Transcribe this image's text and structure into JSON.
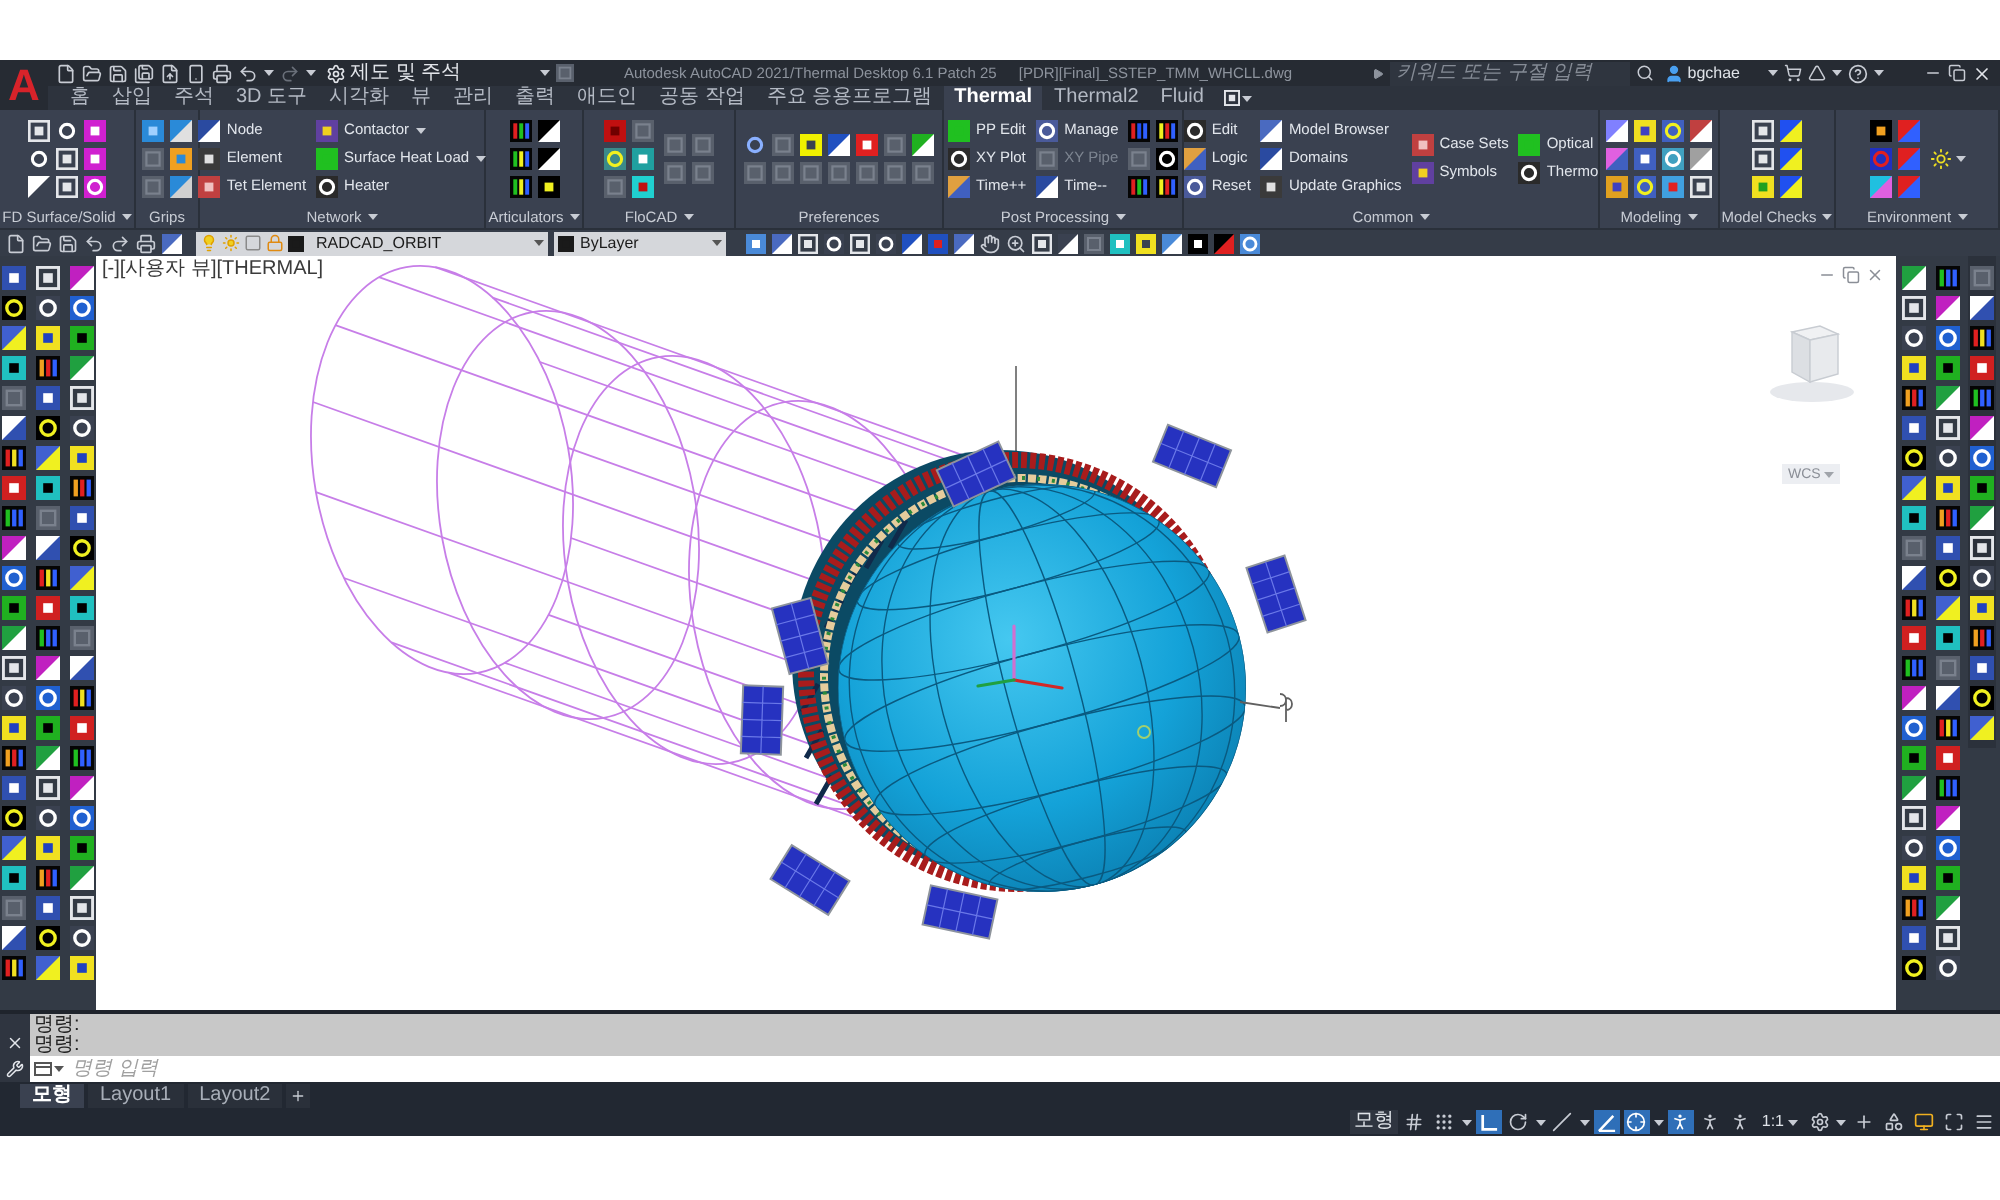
{
  "title_bar": {
    "logo": "A",
    "workspace": "제도 및 주석",
    "title": "Autodesk AutoCAD 2021/Thermal Desktop 6.1 Patch 25",
    "file": "[PDR][Final]_SSTEP_TMM_WHCLL.dwg",
    "search": {
      "placeholder": "키워드 또는 구절 입력"
    },
    "user": "bgchae"
  },
  "ribbon_tabs": [
    {
      "label": "홈",
      "selected": false
    },
    {
      "label": "삽입",
      "selected": false
    },
    {
      "label": "주석",
      "selected": false
    },
    {
      "label": "3D 도구",
      "selected": false
    },
    {
      "label": "시각화",
      "selected": false
    },
    {
      "label": "뷰",
      "selected": false
    },
    {
      "label": "관리",
      "selected": false
    },
    {
      "label": "출력",
      "selected": false
    },
    {
      "label": "애드인",
      "selected": false
    },
    {
      "label": "공동 작업",
      "selected": false
    },
    {
      "label": "주요 응용프로그램",
      "selected": false
    },
    {
      "label": "Thermal",
      "selected": true
    },
    {
      "label": "Thermal2",
      "selected": false
    },
    {
      "label": "Fluid",
      "selected": false
    }
  ],
  "ribbon_panels": [
    {
      "title": "FD Surface/Solid",
      "menu": true
    },
    {
      "title": "Grips",
      "menu": false
    },
    {
      "title": "Network",
      "menu": true,
      "columns": [
        [
          {
            "label": "Node",
            "dropdown": false,
            "disabled": false
          },
          {
            "label": "Element",
            "dropdown": false,
            "disabled": false
          },
          {
            "label": "Tet Element",
            "dropdown": false,
            "disabled": false
          }
        ],
        [
          {
            "label": "Contactor",
            "dropdown": true,
            "disabled": false
          },
          {
            "label": "Surface Heat Load",
            "dropdown": true,
            "disabled": false
          },
          {
            "label": "Heater",
            "dropdown": false,
            "disabled": false
          }
        ]
      ]
    },
    {
      "title": "Articulators",
      "menu": true
    },
    {
      "title": "FloCAD",
      "menu": true
    },
    {
      "title": "Preferences",
      "menu": false
    },
    {
      "title": "Post Processing",
      "menu": true,
      "columns": [
        [
          {
            "label": "PP Edit",
            "dropdown": false,
            "disabled": false
          },
          {
            "label": "XY Plot",
            "dropdown": false,
            "disabled": false
          },
          {
            "label": "Time++",
            "dropdown": false,
            "disabled": false
          }
        ],
        [
          {
            "label": "Manage",
            "dropdown": false,
            "disabled": false
          },
          {
            "label": "XY Pipe",
            "dropdown": false,
            "disabled": true
          },
          {
            "label": "Time--",
            "dropdown": false,
            "disabled": false
          }
        ]
      ]
    },
    {
      "title": "Common",
      "menu": true,
      "columns": [
        [
          {
            "label": "Edit",
            "dropdown": false,
            "disabled": false
          },
          {
            "label": "Logic",
            "dropdown": false,
            "disabled": false
          },
          {
            "label": "Reset",
            "dropdown": false,
            "disabled": false
          }
        ],
        [
          {
            "label": "Model Browser",
            "dropdown": false,
            "disabled": false
          },
          {
            "label": "Domains",
            "dropdown": false,
            "disabled": false
          },
          {
            "label": "Update Graphics",
            "dropdown": false,
            "disabled": false
          }
        ],
        [
          {
            "label": "Case Sets",
            "dropdown": false,
            "disabled": false
          },
          {
            "label": "Symbols",
            "dropdown": false,
            "disabled": false
          }
        ],
        [
          {
            "label": "Optical",
            "dropdown": false,
            "disabled": false
          },
          {
            "label": "Thermo",
            "dropdown": false,
            "disabled": false
          }
        ]
      ]
    },
    {
      "title": "Modeling",
      "menu": true
    },
    {
      "title": "Model Checks",
      "menu": true
    },
    {
      "title": "Environment",
      "menu": true
    }
  ],
  "toolbar": {
    "layer": "RADCAD_ORBIT",
    "properties_control": "ByLayer"
  },
  "viewport": {
    "controls": [
      "[-]",
      "[사용자 뷰]",
      "[THERMAL]"
    ],
    "coordinate_system": "WCS"
  },
  "command_line": {
    "history": [
      "명령:",
      "명령:"
    ],
    "placeholder": "명령 입력"
  },
  "layout_tabs": [
    {
      "label": "모형",
      "selected": true
    },
    {
      "label": "Layout1",
      "selected": false
    },
    {
      "label": "Layout2",
      "selected": false
    }
  ],
  "status_bar": {
    "space": "모형",
    "toggles": [
      {
        "kind": "grid",
        "on": false,
        "dropdown": false
      },
      {
        "kind": "snap",
        "on": false,
        "dropdown": true
      },
      {
        "kind": "ortho",
        "on": true,
        "dropdown": false
      },
      {
        "kind": "polar",
        "on": false,
        "dropdown": true
      },
      {
        "kind": "isometric",
        "on": false,
        "dropdown": true
      },
      {
        "kind": "tracking",
        "on": true,
        "dropdown": false
      },
      {
        "kind": "osnap",
        "on": true,
        "dropdown": true
      },
      {
        "kind": "annotation",
        "on": true,
        "dropdown": false
      },
      {
        "kind": "autoscale",
        "on": false,
        "dropdown": false
      },
      {
        "kind": "annoscale",
        "on": false,
        "dropdown": false
      }
    ],
    "scale": "1:1",
    "tools": [
      {
        "kind": "settings",
        "dropdown": true
      },
      {
        "kind": "plus",
        "dropdown": false
      },
      {
        "kind": "isolate",
        "dropdown": false
      },
      {
        "kind": "performance",
        "dropdown": false
      },
      {
        "kind": "fullscreen",
        "dropdown": false
      },
      {
        "kind": "menu",
        "dropdown": false
      }
    ]
  }
}
